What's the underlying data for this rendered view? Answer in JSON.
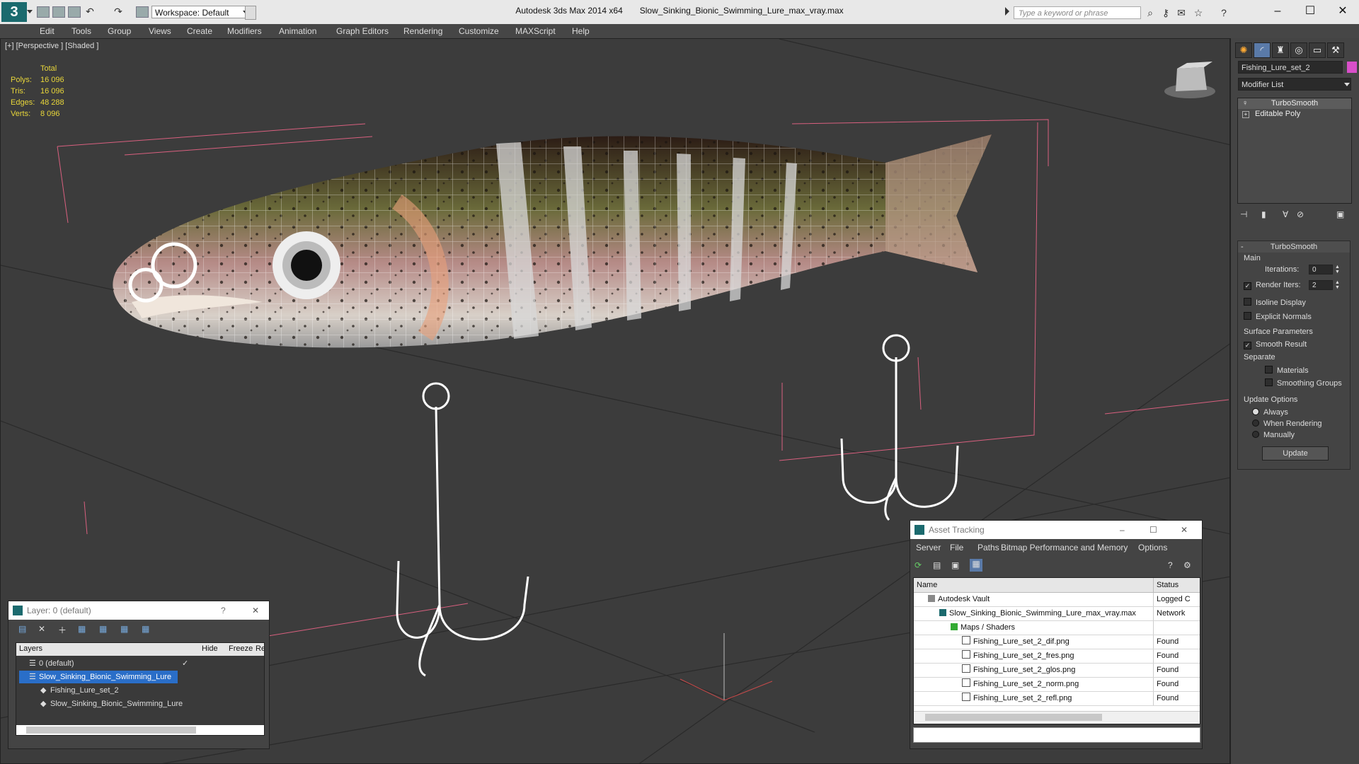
{
  "titlebar": {
    "workspace": "Workspace: Default",
    "app": "Autodesk 3ds Max  2014 x64",
    "file": "Slow_Sinking_Bionic_Swimming_Lure_max_vray.max",
    "search_placeholder": "Type a keyword or phrase"
  },
  "menu": [
    "Edit",
    "Tools",
    "Group",
    "Views",
    "Create",
    "Modifiers",
    "Animation",
    "Graph Editors",
    "Rendering",
    "Customize",
    "MAXScript",
    "Help"
  ],
  "viewport": {
    "label": "[+] [Perspective ] [Shaded ]",
    "stats": {
      "header": "Total",
      "rows": [
        {
          "label": "Polys:",
          "value": "16 096"
        },
        {
          "label": "Tris:",
          "value": "16 096"
        },
        {
          "label": "Edges:",
          "value": "48 288"
        },
        {
          "label": "Verts:",
          "value": "8 096"
        }
      ]
    }
  },
  "command_panel": {
    "object_name": "Fishing_Lure_set_2",
    "object_color": "#d94fc9",
    "modifier_list": "Modifier List",
    "stack": [
      "TurboSmooth",
      "Editable Poly"
    ],
    "rollout_title": "TurboSmooth",
    "main_label": "Main",
    "iterations_label": "Iterations:",
    "iterations_value": "0",
    "render_iters_label": "Render Iters:",
    "render_iters_value": "2",
    "isoline": "Isoline Display",
    "explicit": "Explicit Normals",
    "surface_params": "Surface Parameters",
    "smooth_result": "Smooth Result",
    "separate": "Separate",
    "materials": "Materials",
    "smoothing_groups": "Smoothing Groups",
    "update_options": "Update Options",
    "always": "Always",
    "when_rendering": "When Rendering",
    "manually": "Manually",
    "update_button": "Update"
  },
  "layer_dialog": {
    "title": "Layer: 0 (default)",
    "help": "?",
    "columns": [
      "Layers",
      "Hide",
      "Freeze",
      "Ren"
    ],
    "rows": [
      {
        "name": "0 (default)",
        "indent": 1,
        "selected": false
      },
      {
        "name": "Slow_Sinking_Bionic_Swimming_Lure",
        "indent": 1,
        "selected": true
      },
      {
        "name": "Fishing_Lure_set_2",
        "indent": 2,
        "selected": false
      },
      {
        "name": "Slow_Sinking_Bionic_Swimming_Lure",
        "indent": 2,
        "selected": false
      }
    ]
  },
  "asset_tracking": {
    "title": "Asset Tracking",
    "menu": [
      "Server",
      "File",
      "Paths",
      "Bitmap Performance and Memory",
      "Options"
    ],
    "columns": [
      "Name",
      "Status"
    ],
    "rows": [
      {
        "name": "Autodesk Vault",
        "status": "Logged C",
        "indent": 1
      },
      {
        "name": "Slow_Sinking_Bionic_Swimming_Lure_max_vray.max",
        "status": "Network",
        "indent": 2
      },
      {
        "name": "Maps / Shaders",
        "status": "",
        "indent": 3
      },
      {
        "name": "Fishing_Lure_set_2_dif.png",
        "status": "Found",
        "indent": 4
      },
      {
        "name": "Fishing_Lure_set_2_fres.png",
        "status": "Found",
        "indent": 4
      },
      {
        "name": "Fishing_Lure_set_2_glos.png",
        "status": "Found",
        "indent": 4
      },
      {
        "name": "Fishing_Lure_set_2_norm.png",
        "status": "Found",
        "indent": 4
      },
      {
        "name": "Fishing_Lure_set_2_refl.png",
        "status": "Found",
        "indent": 4
      }
    ]
  }
}
